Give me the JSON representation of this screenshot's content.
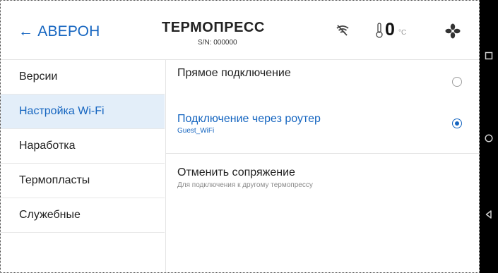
{
  "header": {
    "back_label": "← АВЕРОН",
    "title": "ТЕРМОПРЕСС",
    "serial": "S/N: 000000",
    "temperature_value": "0",
    "temperature_unit": "°C",
    "icons": [
      "wifi-off-icon",
      "thermometer-icon",
      "fan-icon"
    ]
  },
  "sidebar": {
    "items": [
      {
        "label": "Версии"
      },
      {
        "label": "Настройка Wi-Fi",
        "active": true
      },
      {
        "label": "Наработка"
      },
      {
        "label": "Термопласты"
      },
      {
        "label": "Служебные"
      }
    ]
  },
  "wifi": {
    "options": [
      {
        "title": "Прямое подключение",
        "subtitle": "",
        "selected": false
      },
      {
        "title": "Подключение через роутер",
        "subtitle": "Guest_WiFi",
        "selected": true
      }
    ],
    "unpair": {
      "title": "Отменить сопряжение",
      "subtitle": "Для подключения к другому термопрессу"
    }
  },
  "android_nav": {
    "icons": [
      "recent-apps-icon",
      "home-icon",
      "back-icon"
    ]
  },
  "colors": {
    "accent": "#1565c0",
    "active_bg": "#e3eef9",
    "divider": "#e4e4e4",
    "nav_bar": "#000000"
  }
}
